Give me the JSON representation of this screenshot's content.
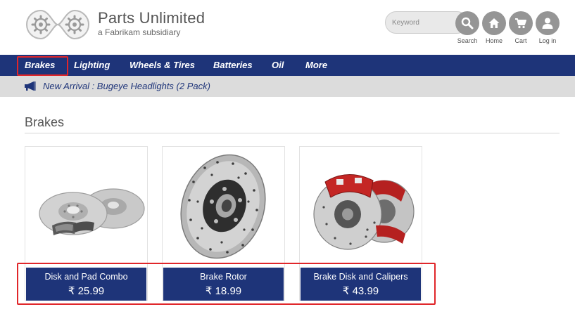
{
  "brand": {
    "title": "Parts Unlimited",
    "subtitle": "a Fabrikam subsidiary"
  },
  "header": {
    "search_placeholder": "Keyword",
    "buttons": [
      {
        "label": "Search",
        "icon": "search-icon"
      },
      {
        "label": "Home",
        "icon": "home-icon"
      },
      {
        "label": "Cart",
        "icon": "cart-icon"
      },
      {
        "label": "Log in",
        "icon": "user-icon"
      }
    ]
  },
  "nav": {
    "items": [
      {
        "label": "Brakes",
        "active": true
      },
      {
        "label": "Lighting"
      },
      {
        "label": "Wheels & Tires"
      },
      {
        "label": "Batteries"
      },
      {
        "label": "Oil"
      },
      {
        "label": "More"
      }
    ]
  },
  "announcement": {
    "icon": "megaphone-icon",
    "text": "New Arrival : Bugeye Headlights (2 Pack)"
  },
  "section": {
    "title": "Brakes"
  },
  "products": [
    {
      "name": "Disk and Pad Combo",
      "price": "₹ 25.99",
      "image": "disk-pad-combo-image"
    },
    {
      "name": "Brake Rotor",
      "price": "₹ 18.99",
      "image": "brake-rotor-image"
    },
    {
      "name": "Brake Disk and Calipers",
      "price": "₹ 43.99",
      "image": "brake-calipers-image"
    }
  ],
  "colors": {
    "nav_bg": "#1e3479",
    "announce_bg": "#dcdcdc",
    "highlight": "#e0262a",
    "icon_circle": "#959595"
  }
}
